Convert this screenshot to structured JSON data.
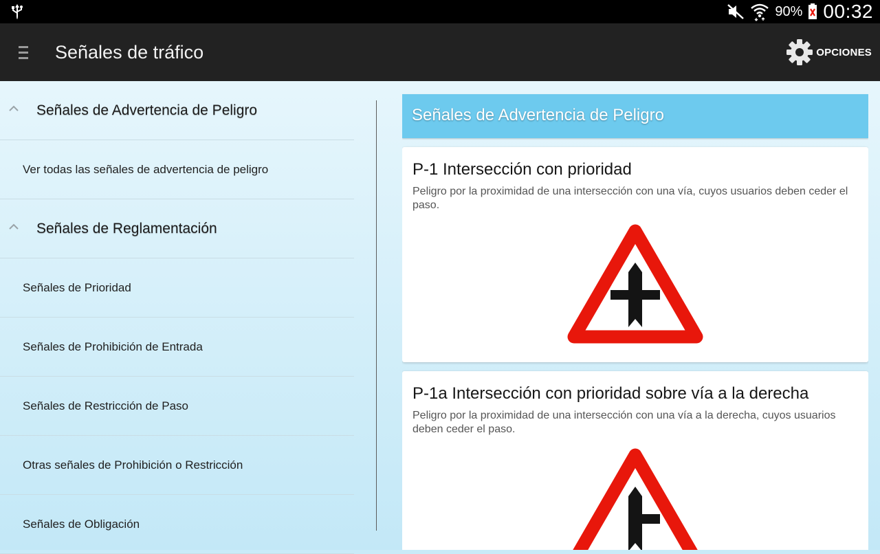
{
  "status_bar": {
    "battery_percent": "90%",
    "time": "00:32"
  },
  "action_bar": {
    "title": "Señales de tráfico",
    "options_label": "OPCIONES"
  },
  "sidebar": {
    "groups": [
      {
        "label": "Señales de Advertencia de Peligro",
        "items": [
          "Ver todas las señales de advertencia de peligro"
        ]
      },
      {
        "label": "Señales de Reglamentación",
        "items": [
          "Señales de Prioridad",
          "Señales de Prohibición de Entrada",
          "Señales de Restricción de Paso",
          "Otras señales de Prohibición o Restricción",
          "Señales de Obligación"
        ]
      }
    ]
  },
  "main": {
    "section_title": "Señales de Advertencia de Peligro",
    "cards": [
      {
        "title": "P-1 Intersección con prioridad",
        "description": "Peligro por la proximidad de una intersección con una vía, cuyos usuarios deben ceder el paso.",
        "sign_icon": "priority-intersection-sign-icon"
      },
      {
        "title": "P-1a Intersección con prioridad sobre vía a la derecha",
        "description": "Peligro por la proximidad de una intersección con una vía a la derecha, cuyos usuarios deben ceder el paso.",
        "sign_icon": "priority-right-intersection-sign-icon"
      }
    ]
  },
  "colors": {
    "status_bar": "#000000",
    "action_bar": "#222222",
    "section_header": "#6dcaee",
    "sign_red": "#e8170b",
    "sign_black": "#141414"
  }
}
